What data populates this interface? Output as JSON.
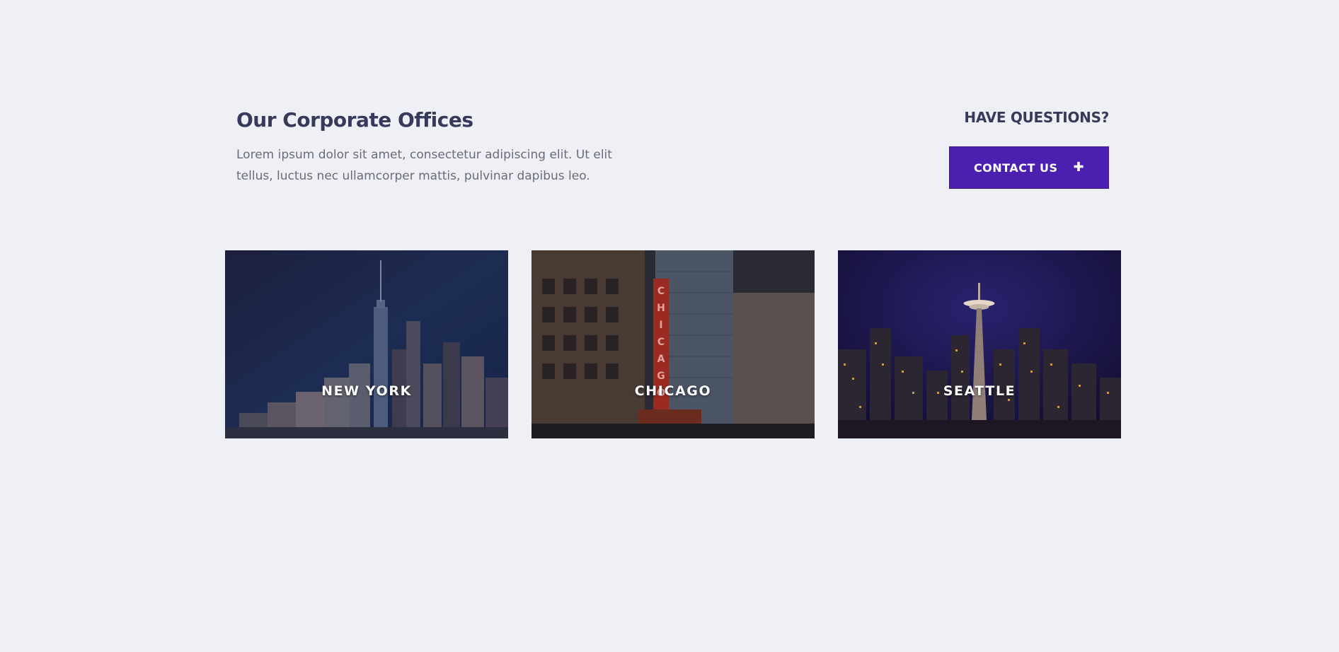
{
  "header": {
    "title": "Our Corporate Offices",
    "intro": "Lorem ipsum dolor sit amet, consectetur adipiscing elit. Ut elit tellus, luctus nec ullamcorper mattis, pulvinar dapibus leo."
  },
  "cta": {
    "heading": "HAVE QUESTIONS?",
    "button_label": "CONTACT US",
    "button_icon": "plus-icon",
    "button_color": "#4b20b1"
  },
  "offices": [
    {
      "name": "NEW YORK"
    },
    {
      "name": "CHICAGO"
    },
    {
      "name": "SEATTLE"
    }
  ],
  "colors": {
    "background": "#eff0f5",
    "heading": "#363a5b",
    "body_text": "#6a6b78"
  }
}
